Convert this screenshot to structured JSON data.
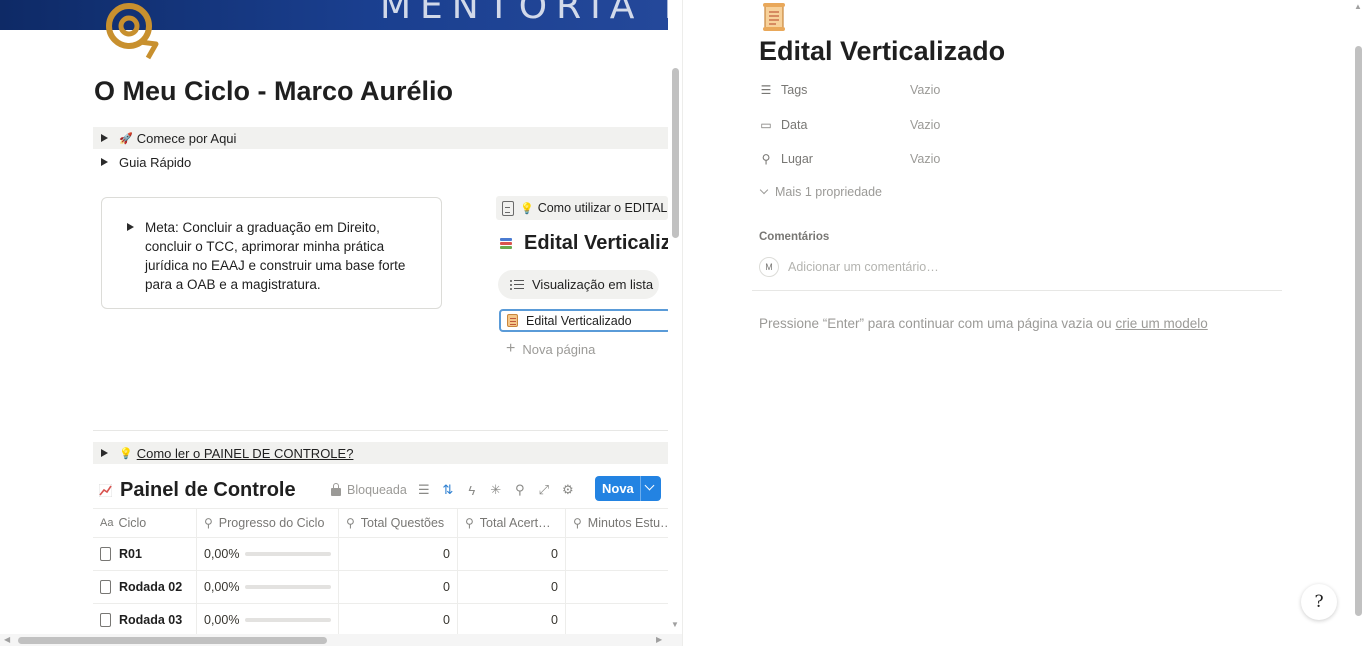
{
  "left": {
    "cover_text": "MENTORIA D",
    "title": "O Meu Ciclo - Marco Aurélio",
    "toggle_start": "Comece por Aqui",
    "toggle_guide": "Guia Rápido",
    "callout_text": "Meta: Concluir a graduação em Direito, concluir o TCC, aprimorar minha prática jurídica no EAAJ e construir uma base forte para a OAB e a magistratura.",
    "linked_page": "Como utilizar o EDITAL",
    "db_title": "Edital Verticalizado",
    "view_tab": "Visualização em lista",
    "card": "Edital Verticalizado",
    "new_page": "Nova página",
    "toggle_panel": "Como ler o PAINEL DE CONTROLE?",
    "panel": {
      "title": "Painel de Controle",
      "locked_label": "Bloqueada",
      "new_button": "Nova",
      "columns": [
        "Ciclo",
        "Progresso do Ciclo",
        "Total Questões",
        "Total Acert…",
        "Minutos Estu…"
      ],
      "rows": [
        {
          "name": "R01",
          "progress_text": "0,00%",
          "progress": 0,
          "questoes": "0",
          "acertos": "0",
          "minutos": ""
        },
        {
          "name": "Rodada 02",
          "progress_text": "0,00%",
          "progress": 0,
          "questoes": "0",
          "acertos": "0",
          "minutos": ""
        },
        {
          "name": "Rodada 03",
          "progress_text": "0,00%",
          "progress": 0,
          "questoes": "0",
          "acertos": "0",
          "minutos": ""
        }
      ]
    }
  },
  "right": {
    "title": "Edital Verticalizado",
    "properties": [
      {
        "name": "Tags",
        "value": "Vazio",
        "icon": "list-icon"
      },
      {
        "name": "Data",
        "value": "Vazio",
        "icon": "calendar-icon"
      },
      {
        "name": "Lugar",
        "value": "Vazio",
        "icon": "location-pin-icon"
      }
    ],
    "more_props": "Mais 1 propriedade",
    "comments_label": "Comentários",
    "avatar_initial": "M",
    "comment_placeholder": "Adicionar um comentário…",
    "hint_text": "Pressione “Enter” para continuar com uma página vazia ou ",
    "hint_link": "crie um modelo"
  },
  "colors": {
    "accent": "#2383e2",
    "cover": "#1a3f8f",
    "logo": "#c8902e"
  }
}
